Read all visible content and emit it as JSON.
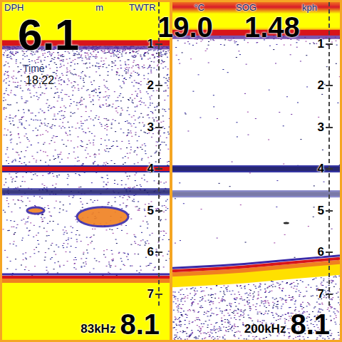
{
  "header": {
    "fields": [
      {
        "label": "DPH",
        "value": "6.1",
        "unit": "m"
      },
      {
        "label": "TWTR",
        "value": "19.0",
        "unit": "°C"
      },
      {
        "label": "SOG",
        "value": "1.48",
        "unit": "kph"
      }
    ],
    "time": {
      "label": "Time",
      "value": "18:22"
    }
  },
  "panes": [
    {
      "frequency": "83kHz",
      "range": "8.1",
      "scale": [
        "1",
        "2",
        "3",
        "4",
        "5",
        "6",
        "7"
      ],
      "clutter": 0.8,
      "surface_depth": 1.05,
      "bottom": [
        6.65,
        6.65,
        6.65,
        6.65,
        6.65,
        6.65,
        6.65,
        6.65
      ],
      "layers": [
        {
          "depth": 4.0,
          "strength": 1
        },
        {
          "depth": 4.55,
          "strength": 0.75
        }
      ],
      "targets": [
        {
          "x": 0.6,
          "depth": 5.15,
          "size": 0.45
        },
        {
          "x": 0.2,
          "depth": 5.0,
          "size": 0.15
        }
      ]
    },
    {
      "frequency": "200kHz",
      "range": "8.1",
      "scale": [
        "1",
        "2",
        "3",
        "4",
        "5",
        "6",
        "7"
      ],
      "clutter": 0.04,
      "surface_depth": 0.8,
      "bottom": [
        6.5,
        6.47,
        6.44,
        6.4,
        6.35,
        6.3,
        6.25,
        6.2
      ],
      "layers": [
        {
          "depth": 4.0,
          "strength": 0.9
        },
        {
          "depth": 4.6,
          "strength": 0.3
        }
      ],
      "targets": [
        {
          "x": 0.68,
          "depth": 5.3,
          "size": 0.05
        }
      ]
    }
  ]
}
